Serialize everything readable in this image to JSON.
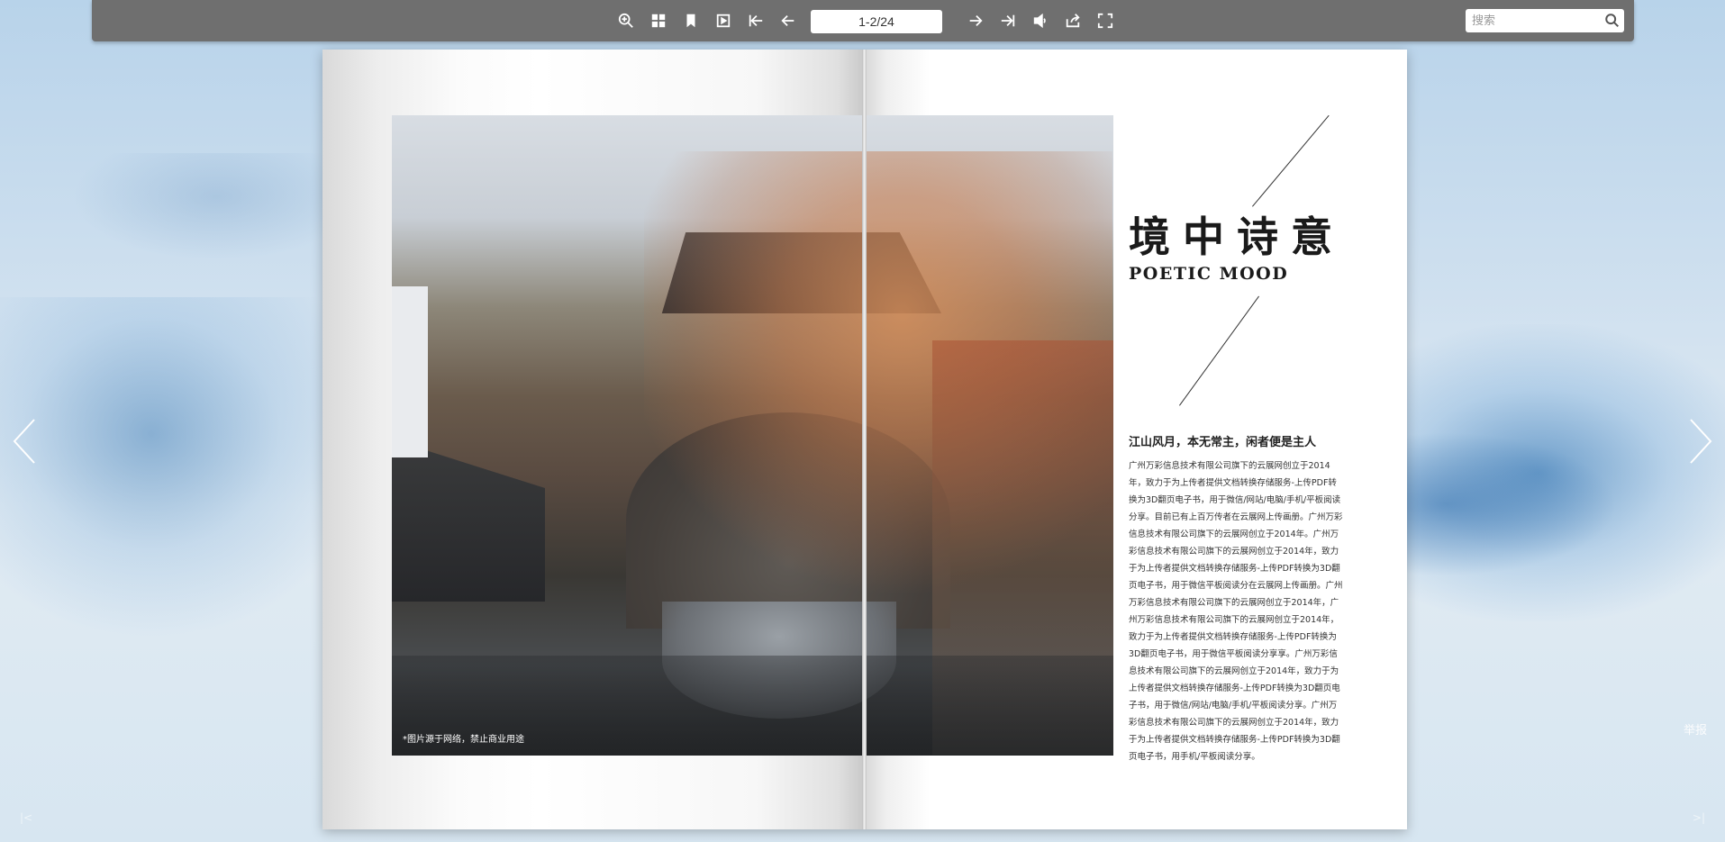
{
  "toolbar": {
    "page_indicator": "1-2/24",
    "search_placeholder": "搜索"
  },
  "book": {
    "title_cn": "境中诗意",
    "title_en": "POETIC MOOD",
    "subtitle": "江山风月，本无常主，闲者便是主人",
    "body": "广州万彩信息技术有限公司旗下的云展网创立于2014年，致力于为上传者提供文档转换存储服务-上传PDF转换为3D翻页电子书，用于微信/网站/电脑/手机/平板阅读分享。目前已有上百万传者在云展网上传画册。广州万彩信息技术有限公司旗下的云展网创立于2014年。广州万彩信息技术有限公司旗下的云展网创立于2014年，致力于为上传者提供文档转换存储服务-上传PDF转换为3D翻页电子书，用于微信平板阅读分在云展网上传画册。广州万彩信息技术有限公司旗下的云展网创立于2014年，广州万彩信息技术有限公司旗下的云展网创立于2014年，致力于为上传者提供文档转换存储服务-上传PDF转换为3D翻页电子书，用于微信平板阅读分享享。广州万彩信息技术有限公司旗下的云展网创立于2014年，致力于为上传者提供文档转换存储服务-上传PDF转换为3D翻页电子书，用于微信/网站/电脑/手机/平板阅读分享。广州万彩信息技术有限公司旗下的云展网创立于2014年，致力于为上传者提供文档转换存储服务-上传PDF转换为3D翻页电子书，用手机/平板阅读分享。",
    "photo_credit": "*图片源于网络，禁止商业用途"
  },
  "report_label": "举报",
  "icons": {
    "zoom": "zoom-in-icon",
    "thumbnails": "thumbnails-icon",
    "bookmark": "bookmark-icon",
    "autoplay": "autoplay-icon",
    "first": "first-page-icon",
    "prev": "previous-page-icon",
    "next": "next-page-icon",
    "last": "last-page-icon",
    "sound": "sound-icon",
    "share": "share-icon",
    "fullscreen": "fullscreen-icon",
    "search": "search-icon"
  }
}
